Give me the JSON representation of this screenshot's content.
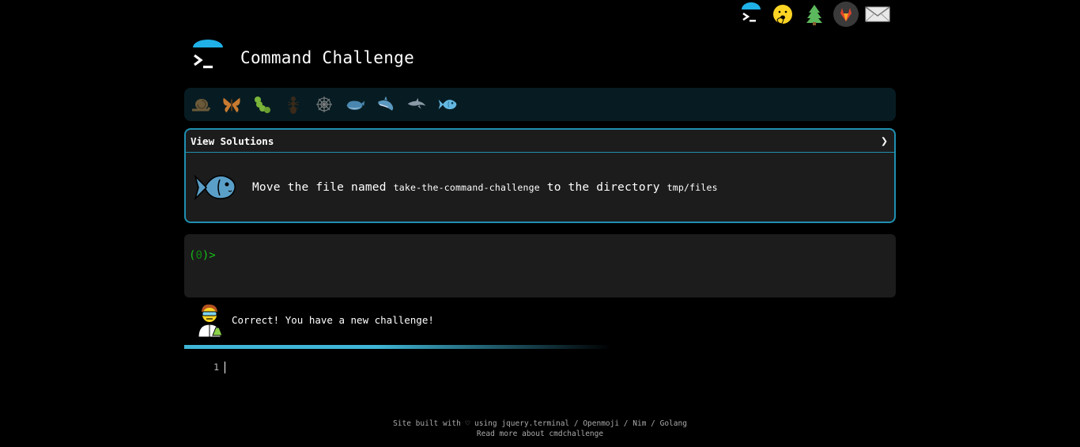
{
  "top_nav": {
    "items": [
      {
        "name": "terminal-icon"
      },
      {
        "name": "hand-over-mouth-face-icon"
      },
      {
        "name": "evergreen-tree-icon"
      },
      {
        "name": "gitlab-icon"
      },
      {
        "name": "envelope-icon"
      }
    ]
  },
  "header": {
    "title": "Command Challenge"
  },
  "levels": [
    {
      "name": "snail-icon"
    },
    {
      "name": "butterfly-icon"
    },
    {
      "name": "caterpillar-icon"
    },
    {
      "name": "ant-icon"
    },
    {
      "name": "spider-web-icon"
    },
    {
      "name": "whale-icon"
    },
    {
      "name": "shark-icon"
    },
    {
      "name": "dolphin-icon"
    },
    {
      "name": "fish-icon",
      "active": true
    }
  ],
  "challenge": {
    "solutions_label": "View Solutions",
    "chevron": "❯",
    "text_before": "Move the file named ",
    "filename": "take-the-command-challenge",
    "text_middle": " to the directory ",
    "directory": "tmp/files"
  },
  "terminal": {
    "prompt_open": "(",
    "prompt_num": "0",
    "prompt_close": ")>"
  },
  "feedback": {
    "message": "Correct! You have a new challenge!"
  },
  "editor": {
    "line_number": "1"
  },
  "footer": {
    "line1_prefix": "Site built with ♡ using ",
    "link_jquery": "jquery.terminal",
    "sep1": " / ",
    "link_openmoji": "Openmoji",
    "sep2": " / ",
    "link_nim": "Nim",
    "sep3": " / ",
    "link_golang": "Golang",
    "line2_link": "Read more about cmdchallenge"
  },
  "colors": {
    "accent": "#1f8fb0",
    "prompt_green": "#17c117",
    "panel_bg": "#1c1c1c",
    "level_bar_bg": "#071c22"
  }
}
